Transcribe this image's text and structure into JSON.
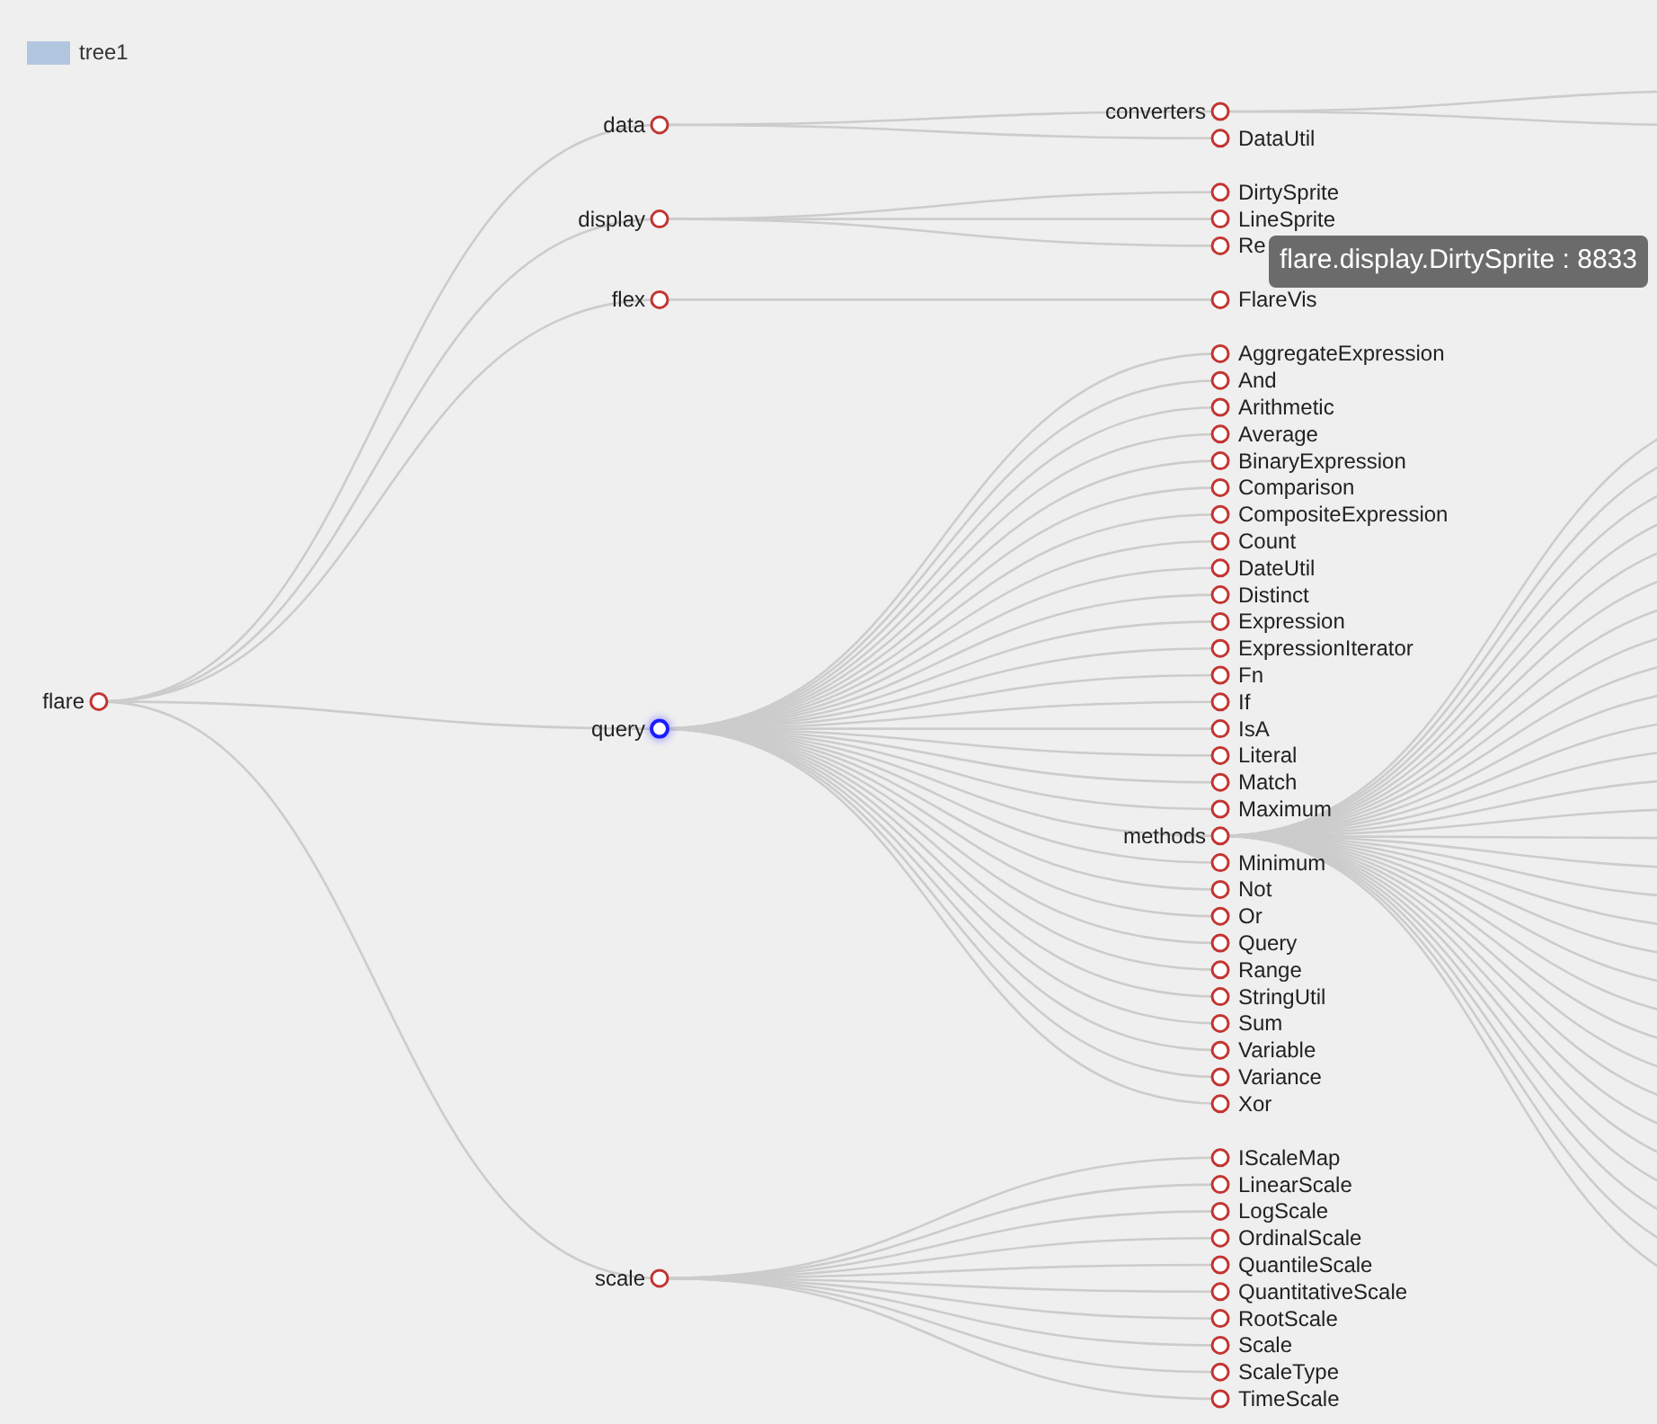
{
  "legend": {
    "label": "tree1"
  },
  "tree": {
    "name": "flare",
    "selected": false,
    "children": [
      {
        "name": "data",
        "selected": false,
        "children": [
          {
            "name": "converters",
            "kind": "branch",
            "selected": false
          },
          {
            "name": "DataUtil",
            "kind": "leaf",
            "selected": false
          }
        ]
      },
      {
        "name": "display",
        "selected": false,
        "children": [
          {
            "name": "DirtySprite",
            "kind": "leaf",
            "selected": false
          },
          {
            "name": "LineSprite",
            "kind": "leaf",
            "selected": false
          },
          {
            "name": "Re",
            "kind": "leaf",
            "selected": false
          }
        ]
      },
      {
        "name": "flex",
        "selected": false,
        "children": [
          {
            "name": "FlareVis",
            "kind": "leaf",
            "selected": false
          }
        ]
      },
      {
        "name": "query",
        "selected": true,
        "children": [
          {
            "name": "AggregateExpression",
            "kind": "leaf",
            "selected": false
          },
          {
            "name": "And",
            "kind": "leaf",
            "selected": false
          },
          {
            "name": "Arithmetic",
            "kind": "leaf",
            "selected": false
          },
          {
            "name": "Average",
            "kind": "leaf",
            "selected": false
          },
          {
            "name": "BinaryExpression",
            "kind": "leaf",
            "selected": false
          },
          {
            "name": "Comparison",
            "kind": "leaf",
            "selected": false
          },
          {
            "name": "CompositeExpression",
            "kind": "leaf",
            "selected": false
          },
          {
            "name": "Count",
            "kind": "leaf",
            "selected": false
          },
          {
            "name": "DateUtil",
            "kind": "leaf",
            "selected": false
          },
          {
            "name": "Distinct",
            "kind": "leaf",
            "selected": false
          },
          {
            "name": "Expression",
            "kind": "leaf",
            "selected": false
          },
          {
            "name": "ExpressionIterator",
            "kind": "leaf",
            "selected": false
          },
          {
            "name": "Fn",
            "kind": "leaf",
            "selected": false
          },
          {
            "name": "If",
            "kind": "leaf",
            "selected": false
          },
          {
            "name": "IsA",
            "kind": "leaf",
            "selected": false
          },
          {
            "name": "Literal",
            "kind": "leaf",
            "selected": false
          },
          {
            "name": "Match",
            "kind": "leaf",
            "selected": false
          },
          {
            "name": "Maximum",
            "kind": "leaf",
            "selected": false
          },
          {
            "name": "methods",
            "kind": "branch",
            "selected": false
          },
          {
            "name": "Minimum",
            "kind": "leaf",
            "selected": false
          },
          {
            "name": "Not",
            "kind": "leaf",
            "selected": false
          },
          {
            "name": "Or",
            "kind": "leaf",
            "selected": false
          },
          {
            "name": "Query",
            "kind": "leaf",
            "selected": false
          },
          {
            "name": "Range",
            "kind": "leaf",
            "selected": false
          },
          {
            "name": "StringUtil",
            "kind": "leaf",
            "selected": false
          },
          {
            "name": "Sum",
            "kind": "leaf",
            "selected": false
          },
          {
            "name": "Variable",
            "kind": "leaf",
            "selected": false
          },
          {
            "name": "Variance",
            "kind": "leaf",
            "selected": false
          },
          {
            "name": "Xor",
            "kind": "leaf",
            "selected": false
          }
        ]
      },
      {
        "name": "scale",
        "selected": false,
        "children": [
          {
            "name": "IScaleMap",
            "kind": "leaf",
            "selected": false
          },
          {
            "name": "LinearScale",
            "kind": "leaf",
            "selected": false
          },
          {
            "name": "LogScale",
            "kind": "leaf",
            "selected": false
          },
          {
            "name": "OrdinalScale",
            "kind": "leaf",
            "selected": false
          },
          {
            "name": "QuantileScale",
            "kind": "leaf",
            "selected": false
          },
          {
            "name": "QuantitativeScale",
            "kind": "leaf",
            "selected": false
          },
          {
            "name": "RootScale",
            "kind": "leaf",
            "selected": false
          },
          {
            "name": "Scale",
            "kind": "leaf",
            "selected": false
          },
          {
            "name": "ScaleType",
            "kind": "leaf",
            "selected": false
          },
          {
            "name": "TimeScale",
            "kind": "leaf",
            "selected": false
          }
        ]
      }
    ]
  },
  "tooltip": {
    "text": "flare.display.DirtySprite : 8833"
  }
}
